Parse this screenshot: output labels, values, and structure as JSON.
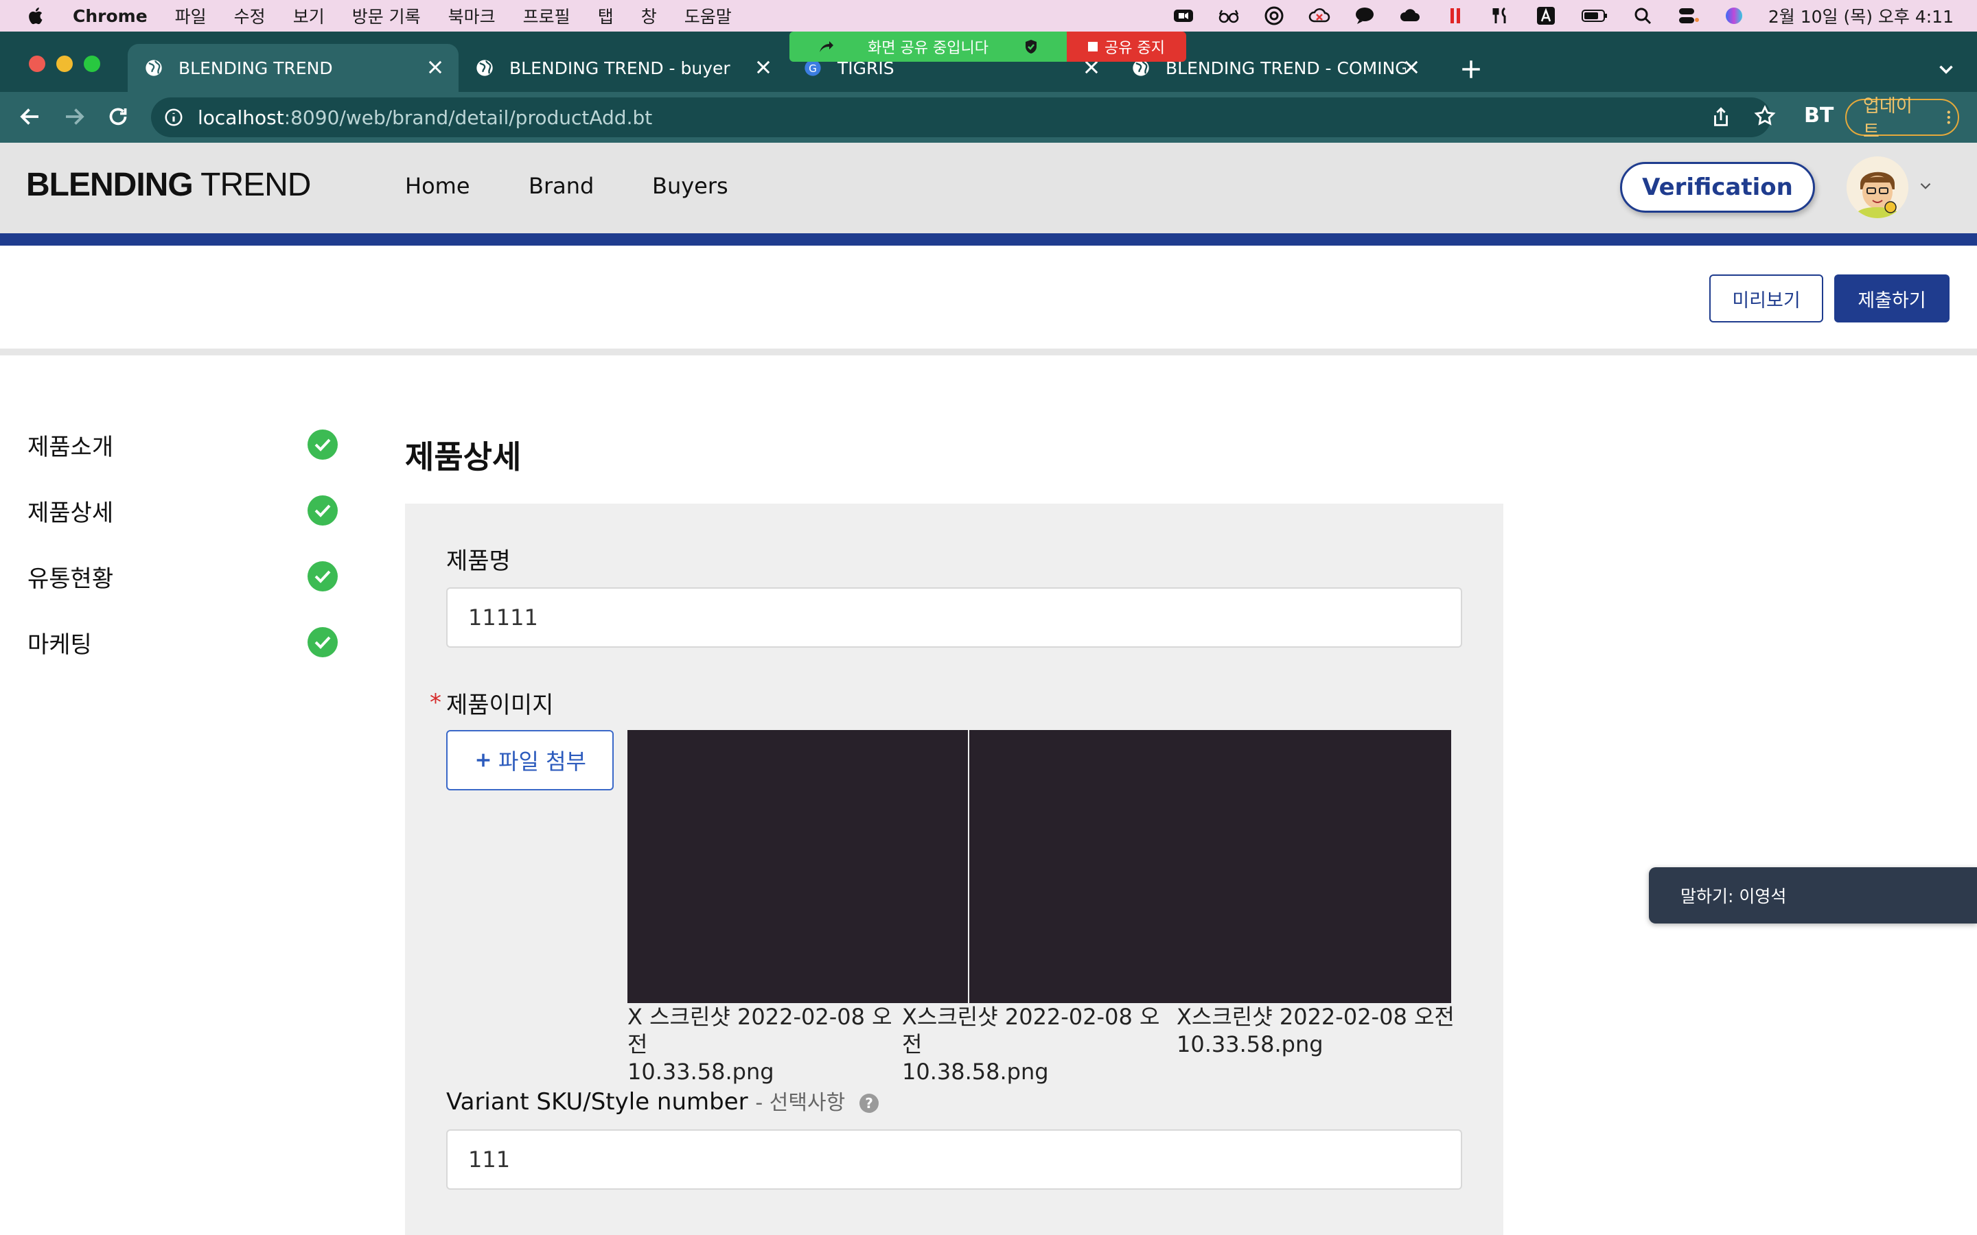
{
  "menubar": {
    "app_name": "Chrome",
    "items": [
      "파일",
      "수정",
      "보기",
      "방문 기록",
      "북마크",
      "프로필",
      "탭",
      "창",
      "도움말"
    ],
    "datetime": "2월 10일 (목) 오후 4:11"
  },
  "screen_share": {
    "status": "화면 공유 중입니다",
    "stop_label": "공유 중지"
  },
  "tabs": [
    {
      "title": "BLENDING TREND"
    },
    {
      "title": "BLENDING TREND - buyer"
    },
    {
      "title": "TIGRIS"
    },
    {
      "title": "BLENDING TREND - COMING S"
    }
  ],
  "toolbar": {
    "url_host": "localhost",
    "url_path": ":8090/web/brand/detail/productAdd.bt",
    "extension_label": "BT",
    "update_label": "업데이트"
  },
  "site": {
    "logo_bold": "BLENDING",
    "logo_light": " TREND",
    "nav": [
      "Home",
      "Brand",
      "Buyers"
    ],
    "verification_label": "Verification"
  },
  "actions": {
    "preview_label": "미리보기",
    "submit_label": "제출하기"
  },
  "sidebar": {
    "items": [
      {
        "label": "제품소개",
        "complete": true
      },
      {
        "label": "제품상세",
        "complete": true
      },
      {
        "label": "유통현황",
        "complete": true
      },
      {
        "label": "마케팅",
        "complete": true
      }
    ]
  },
  "main": {
    "section_title": "제품상세",
    "product_name": {
      "label": "제품명",
      "value": "11111"
    },
    "product_images": {
      "required_mark": "*",
      "label": "제품이미지",
      "attach_label": "파일 첨부",
      "files": [
        {
          "remove": "X",
          "name_line1": " 스크린샷 2022-02-08 오전",
          "name_line2": "10.33.58.png"
        },
        {
          "remove": "X",
          "name_line1": "스크린샷 2022-02-08 오전",
          "name_line2": "10.38.58.png"
        },
        {
          "remove": "X",
          "name_line1": "스크린샷 2022-02-08 오전",
          "name_line2": "10.33.58.png"
        }
      ]
    },
    "variant_sku": {
      "label": "Variant SKU/Style number",
      "optional": "- 선택사항",
      "help": "?",
      "value": "111"
    }
  },
  "speaking_toast": {
    "text": "말하기: 이영석"
  },
  "colors": {
    "brand_navy": "#1f3c8e",
    "chrome_tab_dark": "#174a4d",
    "chrome_tab_active": "#2c6467",
    "check_green": "#3cbb53",
    "share_green": "#3fc65a",
    "share_red": "#e1342e"
  }
}
